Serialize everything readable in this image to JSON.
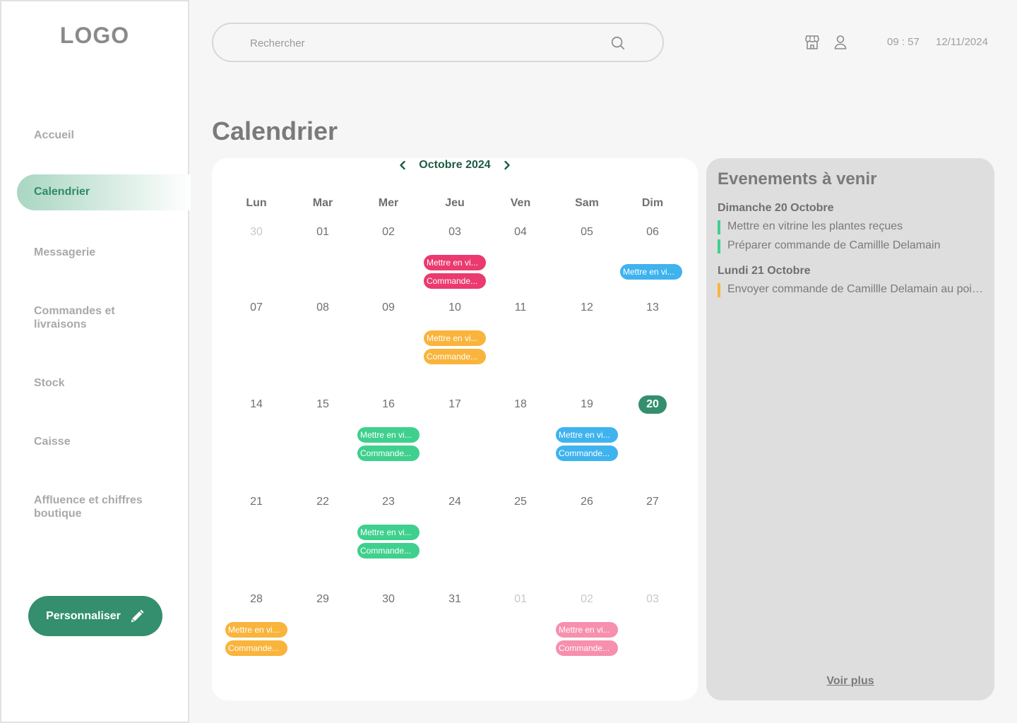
{
  "logo": "LOGO",
  "nav": {
    "items": [
      {
        "label": "Accueil",
        "active": false
      },
      {
        "label": "Calendrier",
        "active": true
      },
      {
        "label": "Messagerie",
        "active": false
      },
      {
        "label": "Commandes et livraisons",
        "active": false
      },
      {
        "label": "Stock",
        "active": false
      },
      {
        "label": "Caisse",
        "active": false
      },
      {
        "label": "Affluence et chiffres boutique",
        "active": false
      }
    ],
    "customize_label": "Personnaliser"
  },
  "search": {
    "placeholder": "Rechercher",
    "value": ""
  },
  "header": {
    "time": "09 : 57",
    "date": "12/11/2024",
    "icons": [
      "store-icon",
      "user-icon"
    ]
  },
  "page_title": "Calendrier",
  "calendar": {
    "month_label": "Octobre 2024",
    "today": "20",
    "weekdays": [
      "Lun",
      "Mar",
      "Mer",
      "Jeu",
      "Ven",
      "Sam",
      "Dim"
    ],
    "weeks": [
      [
        {
          "d": "30",
          "muted": true
        },
        {
          "d": "01"
        },
        {
          "d": "02"
        },
        {
          "d": "03"
        },
        {
          "d": "04"
        },
        {
          "d": "05"
        },
        {
          "d": "06"
        }
      ],
      [
        {
          "d": "07"
        },
        {
          "d": "08"
        },
        {
          "d": "09"
        },
        {
          "d": "10"
        },
        {
          "d": "11"
        },
        {
          "d": "12"
        },
        {
          "d": "13"
        }
      ],
      [
        {
          "d": "14"
        },
        {
          "d": "15"
        },
        {
          "d": "16"
        },
        {
          "d": "17"
        },
        {
          "d": "18"
        },
        {
          "d": "19"
        },
        {
          "d": "20",
          "today": true
        }
      ],
      [
        {
          "d": "21"
        },
        {
          "d": "22"
        },
        {
          "d": "23"
        },
        {
          "d": "24"
        },
        {
          "d": "25"
        },
        {
          "d": "26"
        },
        {
          "d": "27"
        }
      ],
      [
        {
          "d": "28"
        },
        {
          "d": "29"
        },
        {
          "d": "30"
        },
        {
          "d": "31"
        },
        {
          "d": "01",
          "muted": true
        },
        {
          "d": "02",
          "muted": true
        },
        {
          "d": "03",
          "muted": true
        }
      ]
    ],
    "colors": {
      "red": "#ea3a6e",
      "blue": "#3fb3ee",
      "orange": "#f9b43c",
      "green": "#3fd08e",
      "pink": "#f78fae"
    },
    "events": [
      {
        "week": 0,
        "day": 3,
        "color": "red",
        "labels": [
          "Mettre en vi...",
          "Commande..."
        ]
      },
      {
        "week": 0,
        "day": 6,
        "color": "blue",
        "labels": [
          "Mettre en vi..."
        ]
      },
      {
        "week": 1,
        "day": 3,
        "color": "orange",
        "labels": [
          "Mettre en vi...",
          "Commande..."
        ]
      },
      {
        "week": 2,
        "day": 2,
        "color": "green",
        "labels": [
          "Mettre en vi...",
          "Commande..."
        ]
      },
      {
        "week": 2,
        "day": 5,
        "color": "blue",
        "labels": [
          "Mettre en vi...",
          "Commande..."
        ]
      },
      {
        "week": 3,
        "day": 2,
        "color": "green",
        "labels": [
          "Mettre en vi...",
          "Commande..."
        ]
      },
      {
        "week": 4,
        "day": 0,
        "color": "orange",
        "labels": [
          "Mettre en vi...",
          "Commande..."
        ]
      },
      {
        "week": 4,
        "day": 5,
        "color": "pink",
        "labels": [
          "Mettre en vi...",
          "Commande..."
        ]
      }
    ]
  },
  "upcoming": {
    "title": "Evenements à venir",
    "days": [
      {
        "label": "Dimanche 20 Octobre",
        "items": [
          {
            "text": "Mettre en vitrine les plantes reçues",
            "color": "#3fd08e"
          },
          {
            "text": "Préparer commande de Camillle Delamain",
            "color": "#3fd08e"
          }
        ]
      },
      {
        "label": "Lundi 21 Octobre",
        "items": [
          {
            "text": "Envoyer commande de Camillle Delamain au point relais",
            "color": "#f9b43c"
          }
        ]
      }
    ],
    "more_label": "Voir plus"
  }
}
